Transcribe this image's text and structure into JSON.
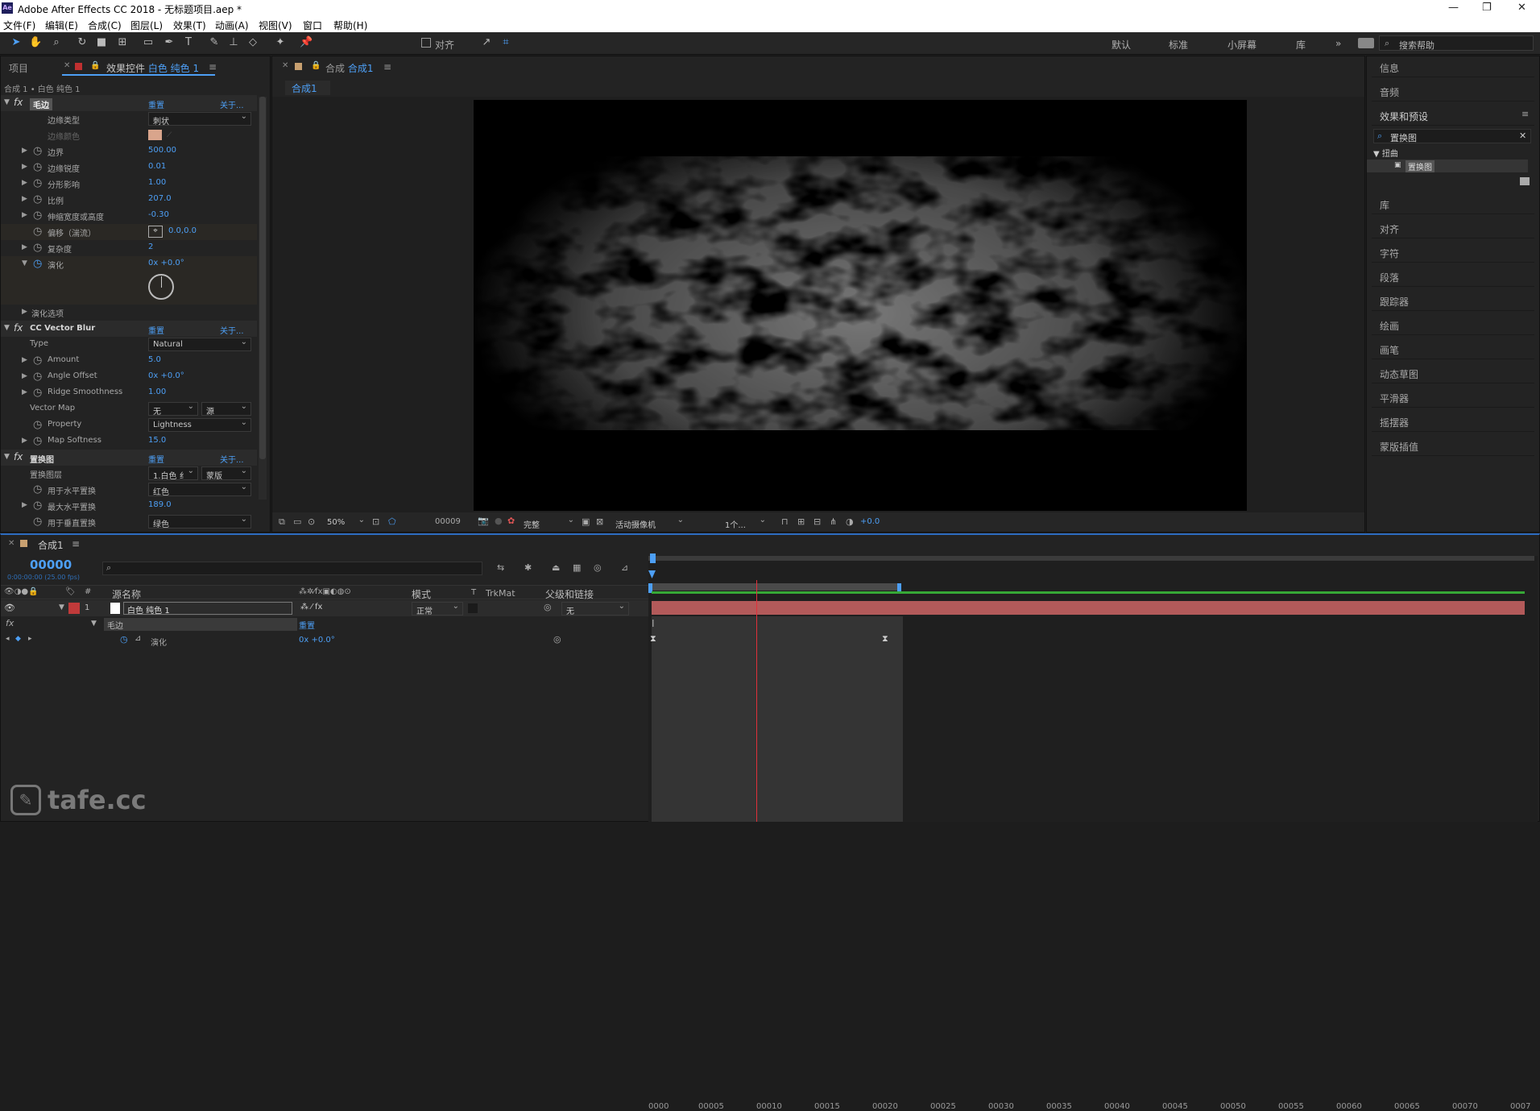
{
  "titlebar": {
    "title": "Adobe After Effects CC 2018 - 无标题项目.aep *",
    "ae": "Ae"
  },
  "menu": [
    "文件(F)",
    "编辑(E)",
    "合成(C)",
    "图层(L)",
    "效果(T)",
    "动画(A)",
    "视图(V)",
    "窗口",
    "帮助(H)"
  ],
  "toolbar": {
    "align_label": "对齐",
    "workspaces": [
      "默认",
      "标准",
      "小屏幕",
      "库"
    ],
    "search_placeholder": "搜索帮助"
  },
  "left_panel": {
    "tab_project": "项目",
    "tab_effects": "效果控件 白色 纯色 1",
    "breadcrumb": "合成 1 • 白色 纯色 1",
    "fx1": {
      "name": "毛边",
      "reset": "重置",
      "about": "关于...",
      "props": [
        {
          "name": "边缘类型",
          "dropdown": "刺状"
        },
        {
          "name": "边缘颜色"
        },
        {
          "name": "边界",
          "value": "500.00"
        },
        {
          "name": "边缘锐度",
          "value": "0.01"
        },
        {
          "name": "分形影响",
          "value": "1.00"
        },
        {
          "name": "比例",
          "value": "207.0"
        },
        {
          "name": "伸缩宽度或高度",
          "value": "-0.30"
        },
        {
          "name": "偏移（湍流）",
          "value": "0.0,0.0"
        },
        {
          "name": "复杂度",
          "value": "2"
        },
        {
          "name": "演化",
          "value": "0x +0.0°"
        },
        {
          "name": "演化选项"
        }
      ]
    },
    "fx2": {
      "name": "CC Vector Blur",
      "reset": "重置",
      "about": "关于...",
      "props": [
        {
          "name": "Type",
          "dropdown": "Natural"
        },
        {
          "name": "Amount",
          "value": "5.0"
        },
        {
          "name": "Angle Offset",
          "value": "0x +0.0°"
        },
        {
          "name": "Ridge Smoothness",
          "value": "1.00"
        },
        {
          "name": "Vector Map",
          "dropdown": "无",
          "dropdown2": "源"
        },
        {
          "name": "Property",
          "dropdown": "Lightness"
        },
        {
          "name": "Map Softness",
          "value": "15.0"
        }
      ]
    },
    "fx3": {
      "name": "置换图",
      "reset": "重置",
      "about": "关于...",
      "props": [
        {
          "name": "置换图层",
          "dropdown": "1.白色 纟",
          "dropdown2": "蒙版"
        },
        {
          "name": "用于水平置换",
          "dropdown": "红色"
        },
        {
          "name": "最大水平置换",
          "value": "189.0"
        },
        {
          "name": "用于垂直置换",
          "dropdown": "绿色"
        }
      ]
    }
  },
  "comp_panel": {
    "tab": "合成 合成1",
    "tab_prefix": "合成",
    "tab_name": "合成1",
    "subtab": "合成1",
    "bottom": {
      "zoom": "50%",
      "frame": "00009",
      "quality": "完整",
      "camera": "活动摄像机",
      "views": "1个...",
      "exposure": "+0.0"
    }
  },
  "right_panel": {
    "info": "信息",
    "audio": "音频",
    "effects_presets": "效果和预设",
    "search_value": "置换图",
    "category": "扭曲",
    "result": "置换图",
    "items": [
      "库",
      "对齐",
      "字符",
      "段落",
      "跟踪器",
      "绘画",
      "画笔",
      "动态草图",
      "平滑器",
      "摇摆器",
      "蒙版插值"
    ]
  },
  "timeline": {
    "tab": "合成1",
    "timecode": "00000",
    "timecode_sub": "0:00:00:00 (25.00 fps)",
    "search_placeholder": "",
    "columns": {
      "source": "源名称",
      "mode": "模式",
      "t": "T",
      "trkmat": "TrkMat",
      "parent": "父级和链接"
    },
    "layer": {
      "index": "1",
      "name": "白色 纯色 1",
      "mode": "正常",
      "parent": "无"
    },
    "effect_row": {
      "name": "毛边",
      "reset": "重置"
    },
    "prop_row": {
      "name": "演化",
      "value": "0x +0.0°"
    },
    "ruler": [
      "0000",
      "00005",
      "00010",
      "00015",
      "00020",
      "00025",
      "00030",
      "00035",
      "00040",
      "00045",
      "00050",
      "00055",
      "00060",
      "00065",
      "00070",
      "0007"
    ]
  },
  "watermark": "tafe.cc"
}
